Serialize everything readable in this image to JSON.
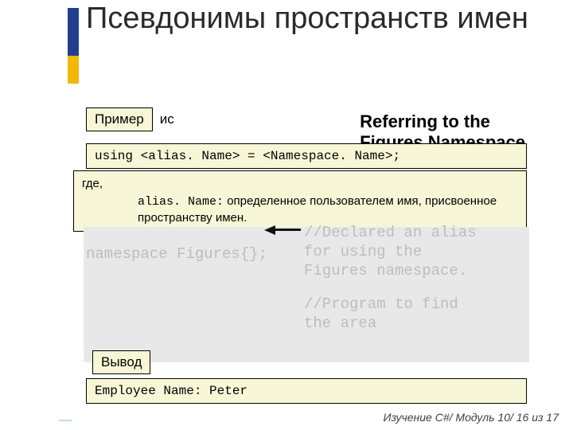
{
  "title": "Псевдонимы пространств имен",
  "labels": {
    "example": "Пример",
    "example_suffix": "ис",
    "output": "Вывод"
  },
  "referring": {
    "line1": "Referring to the",
    "line2": "Figures Namespace"
  },
  "syntax": "using <alias. Name> = <Namespace. Name>;",
  "description": {
    "where": "где,",
    "alias_term": "alias. Name:",
    "alias_def_1": "определенное пользователем имя, присвоенное",
    "alias_def_2": "пространству имен."
  },
  "faded": {
    "namespace_line": "namespace Figures{};",
    "comment_l1": "//Declared an alias",
    "comment_l2": "for using the",
    "comment_l3": "Figures namespace.",
    "comment_l4": "//Program to find",
    "comment_l5": "the area"
  },
  "output": "Employee Name: Peter",
  "footer": "Изучение C#/ Модуль 10/ 16 из 17"
}
